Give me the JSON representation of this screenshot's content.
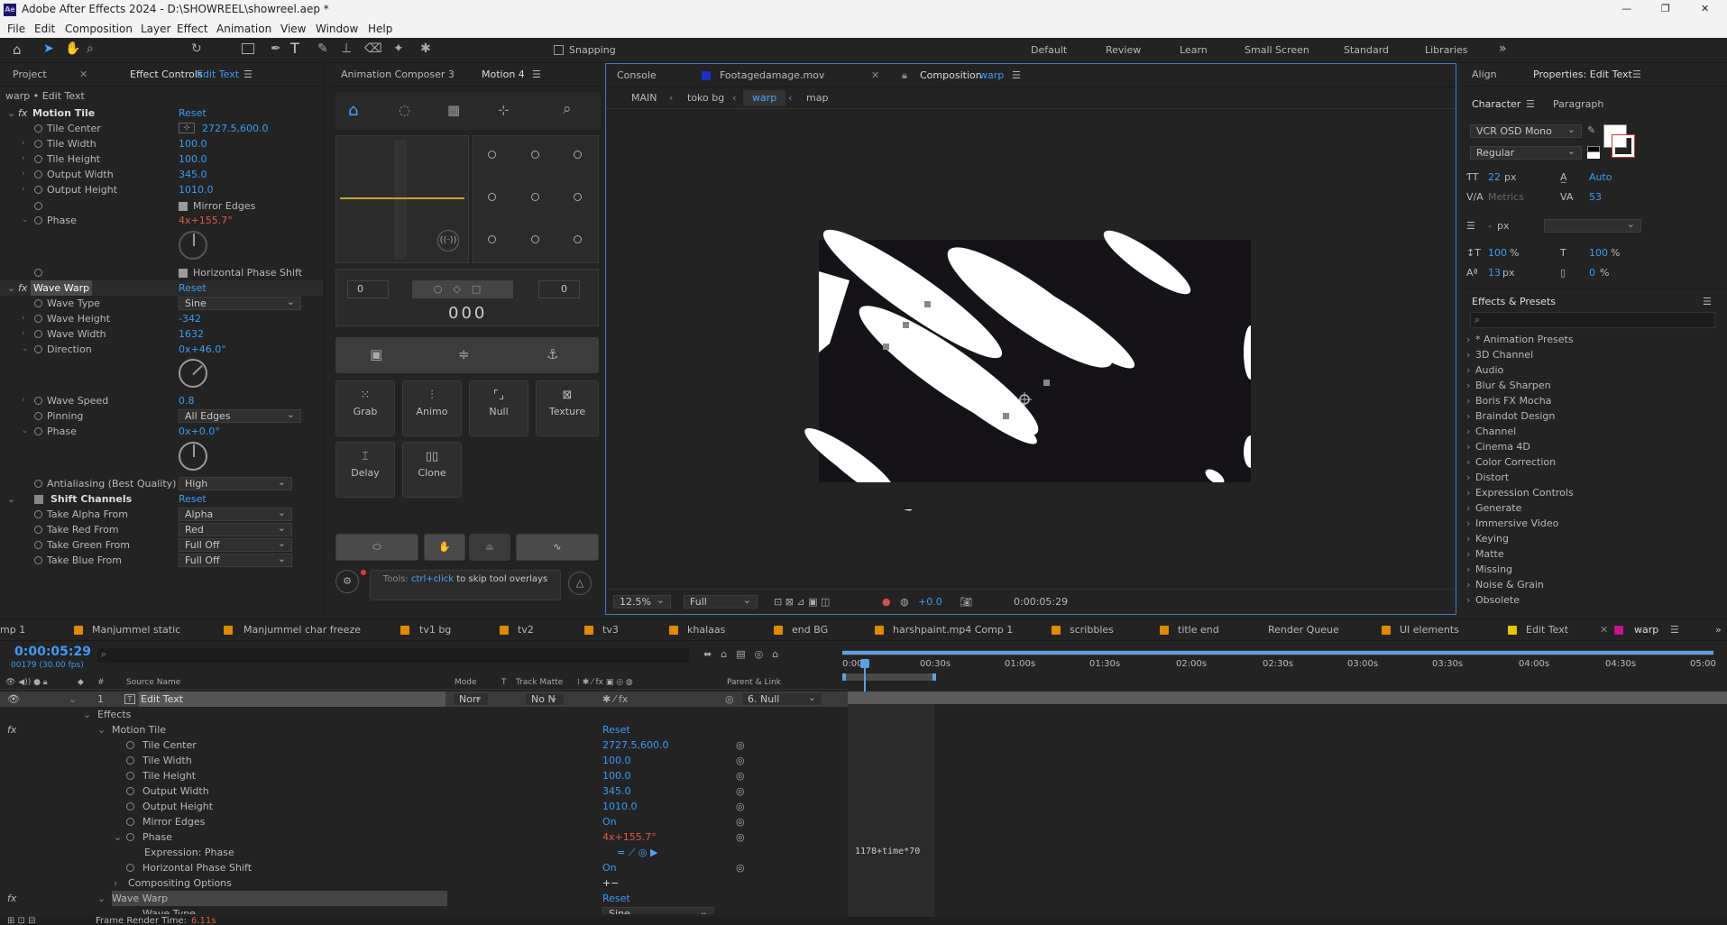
{
  "window": {
    "title": "Adobe After Effects 2024 - D:\\SHOWREEL\\showreel.aep *",
    "minimize": "—",
    "maximize": "❐",
    "close": "✕"
  },
  "menu": [
    "File",
    "Edit",
    "Composition",
    "Layer",
    "Effect",
    "Animation",
    "View",
    "Window",
    "Help"
  ],
  "toolbar": {
    "snapping": "Snapping",
    "workspaces": [
      "Default",
      "Review",
      "Learn",
      "Small Screen",
      "Standard",
      "Libraries"
    ],
    "more": "»"
  },
  "effect_controls": {
    "tab_project": "Project",
    "tab_label": "Effect Controls",
    "tab_target": "Edit Text",
    "layer_path": "warp • Edit Text",
    "motion_tile": {
      "name": "Motion Tile",
      "reset": "Reset",
      "tile_center_label": "Tile Center",
      "tile_center": "2727.5,600.0",
      "tile_width_label": "Tile Width",
      "tile_width": "100.0",
      "tile_height_label": "Tile Height",
      "tile_height": "100.0",
      "output_width_label": "Output Width",
      "output_width": "345.0",
      "output_height_label": "Output Height",
      "output_height": "1010.0",
      "mirror_edges": "Mirror Edges",
      "phase_label": "Phase",
      "phase": "4x+155.7°",
      "horizontal_phase_shift": "Horizontal Phase Shift"
    },
    "wave_warp": {
      "name": "Wave Warp",
      "reset": "Reset",
      "wave_type_label": "Wave Type",
      "wave_type": "Sine",
      "wave_height_label": "Wave Height",
      "wave_height": "-342",
      "wave_width_label": "Wave Width",
      "wave_width": "1632",
      "direction_label": "Direction",
      "direction": "0x+46.0°",
      "wave_speed_label": "Wave Speed",
      "wave_speed": "0.8",
      "pinning_label": "Pinning",
      "pinning": "All Edges",
      "phase_label": "Phase",
      "phase": "0x+0.0°",
      "antialiasing_label": "Antialiasing (Best Quality)",
      "antialiasing": "High"
    },
    "shift_channels": {
      "name": "Shift Channels",
      "reset": "Reset",
      "alpha_label": "Take Alpha From",
      "alpha": "Alpha",
      "red_label": "Take Red From",
      "red": "Red",
      "green_label": "Take Green From",
      "green": "Full Off",
      "blue_label": "Take Blue From",
      "blue": "Full Off"
    }
  },
  "animation_composer": {
    "tab1": "Animation Composer 3",
    "tab2": "Motion 4",
    "left_value": "0",
    "right_value": "0",
    "counter": "000",
    "buttons": [
      "Grab",
      "Animo",
      "Null",
      "Texture",
      "Delay",
      "Clone"
    ],
    "tools_hint_prefix": "Tools:",
    "tools_hint_key": "ctrl+click",
    "tools_hint_suffix": "to skip tool overlays"
  },
  "viewer": {
    "tab_console": "Console",
    "tab_footage": "Footage",
    "footage_name": "damage.mov",
    "tab_comp": "Composition",
    "comp_name": "warp",
    "breadcrumbs": [
      "MAIN",
      "toko bg",
      "warp",
      "map"
    ],
    "zoom": "12.5%",
    "quality": "Full",
    "exposure": "+0.0",
    "timecode": "0:00:05:29"
  },
  "right": {
    "tab_align": "Align",
    "tab_properties": "Properties: Edit Text",
    "tab_character": "Character",
    "tab_paragraph": "Paragraph",
    "font": "VCR OSD Mono",
    "style": "Regular",
    "size": "22",
    "size_unit": "px",
    "leading": "Auto",
    "kerning": "Metrics",
    "tracking": "53",
    "stroke": "-",
    "stroke_unit": "px",
    "vscale": "100",
    "vscale_unit": "%",
    "hscale": "100",
    "hscale_unit": "%",
    "baseline": "13",
    "baseline_unit": "px",
    "tsume": "0",
    "tsume_unit": "%",
    "effects_title": "Effects & Presets",
    "effects": [
      "* Animation Presets",
      "3D Channel",
      "Audio",
      "Blur & Sharpen",
      "Boris FX Mocha",
      "Braindot Design",
      "Channel",
      "Cinema 4D",
      "Color Correction",
      "Distort",
      "Expression Controls",
      "Generate",
      "Immersive Video",
      "Keying",
      "Matte",
      "Missing",
      "Noise & Grain",
      "Obsolete"
    ]
  },
  "timeline": {
    "tabs": [
      "mp 1",
      "Manjummel static",
      "Manjummel char freeze",
      "tv1 bg",
      "tv2",
      "tv3",
      "khalaas",
      "end BG",
      "harshpaint.mp4 Comp 1",
      "scribbles",
      "title end",
      "Render Queue",
      "UI elements",
      "Edit Text",
      "warp"
    ],
    "tab_colors": [
      "#e08a00",
      "#e08a00",
      "#e08a00",
      "#e08a00",
      "#e08a00",
      "#e08a00",
      "#e08a00",
      "#e08a00",
      "#e08a00",
      "#e08a00",
      "#e08a00",
      "#e08a00",
      "#e08a00",
      "#e8c400",
      "#c4148c"
    ],
    "timecode": "0:00:05:29",
    "fps": "00179 (30.00 fps)",
    "col_source": "Source Name",
    "col_mode": "Mode",
    "col_t": "T",
    "col_trackmatte": "Track Matte",
    "col_parent": "Parent & Link",
    "ruler": [
      "0:00s",
      "00:30s",
      "01:00s",
      "01:30s",
      "02:00s",
      "02:30s",
      "03:00s",
      "03:30s",
      "04:00s",
      "04:30s",
      "05:00"
    ],
    "layer": {
      "num": "1",
      "name": "Edit Text",
      "mode": "Norr",
      "matte": "No N",
      "parent": "6. Null"
    },
    "rows": {
      "effects": "Effects",
      "motion_tile": "Motion Tile",
      "reset": "Reset",
      "tile_center": "Tile Center",
      "tile_center_v": "2727.5,600.0",
      "tile_width": "Tile Width",
      "tile_width_v": "100.0",
      "tile_height": "Tile Height",
      "tile_height_v": "100.0",
      "output_width": "Output Width",
      "output_width_v": "345.0",
      "output_height": "Output Height",
      "output_height_v": "1010.0",
      "mirror_edges": "Mirror Edges",
      "mirror_edges_v": "On",
      "phase": "Phase",
      "phase_v": "4x+155.7°",
      "expression_phase": "Expression: Phase",
      "hps": "Horizontal Phase Shift",
      "hps_v": "On",
      "compositing": "Compositing Options",
      "compositing_v": "+−",
      "wave_warp": "Wave Warp",
      "wave_warp_reset": "Reset",
      "wave_type": "Wave Type",
      "wave_type_v": "Sine"
    },
    "expression": "1178+time*70",
    "render_time_label": "Frame Render Time:",
    "render_time": "6.11s"
  }
}
